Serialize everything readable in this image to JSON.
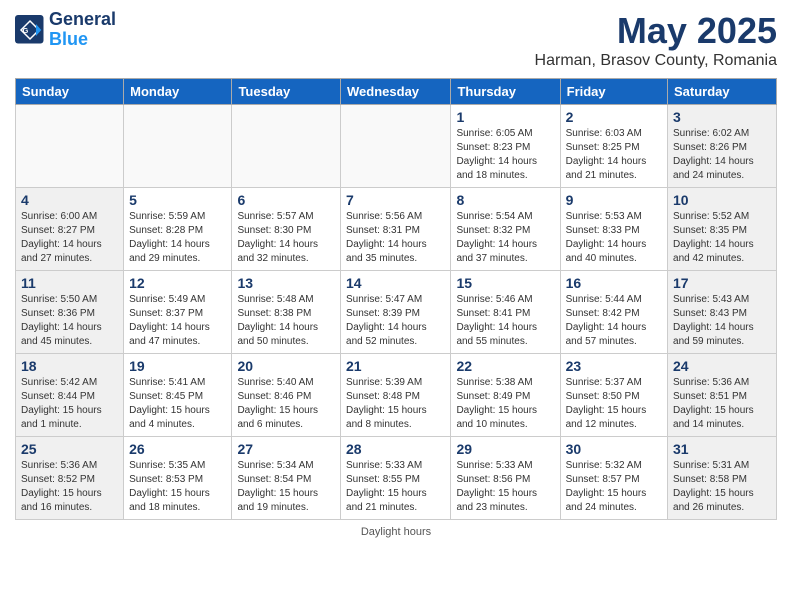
{
  "header": {
    "logo": {
      "general": "General",
      "blue": "Blue"
    },
    "title": "May 2025",
    "location": "Harman, Brasov County, Romania"
  },
  "calendar": {
    "headers": [
      "Sunday",
      "Monday",
      "Tuesday",
      "Wednesday",
      "Thursday",
      "Friday",
      "Saturday"
    ],
    "weeks": [
      [
        {
          "day": "",
          "info": ""
        },
        {
          "day": "",
          "info": ""
        },
        {
          "day": "",
          "info": ""
        },
        {
          "day": "",
          "info": ""
        },
        {
          "day": "1",
          "info": "Sunrise: 6:05 AM\nSunset: 8:23 PM\nDaylight: 14 hours\nand 18 minutes."
        },
        {
          "day": "2",
          "info": "Sunrise: 6:03 AM\nSunset: 8:25 PM\nDaylight: 14 hours\nand 21 minutes."
        },
        {
          "day": "3",
          "info": "Sunrise: 6:02 AM\nSunset: 8:26 PM\nDaylight: 14 hours\nand 24 minutes."
        }
      ],
      [
        {
          "day": "4",
          "info": "Sunrise: 6:00 AM\nSunset: 8:27 PM\nDaylight: 14 hours\nand 27 minutes."
        },
        {
          "day": "5",
          "info": "Sunrise: 5:59 AM\nSunset: 8:28 PM\nDaylight: 14 hours\nand 29 minutes."
        },
        {
          "day": "6",
          "info": "Sunrise: 5:57 AM\nSunset: 8:30 PM\nDaylight: 14 hours\nand 32 minutes."
        },
        {
          "day": "7",
          "info": "Sunrise: 5:56 AM\nSunset: 8:31 PM\nDaylight: 14 hours\nand 35 minutes."
        },
        {
          "day": "8",
          "info": "Sunrise: 5:54 AM\nSunset: 8:32 PM\nDaylight: 14 hours\nand 37 minutes."
        },
        {
          "day": "9",
          "info": "Sunrise: 5:53 AM\nSunset: 8:33 PM\nDaylight: 14 hours\nand 40 minutes."
        },
        {
          "day": "10",
          "info": "Sunrise: 5:52 AM\nSunset: 8:35 PM\nDaylight: 14 hours\nand 42 minutes."
        }
      ],
      [
        {
          "day": "11",
          "info": "Sunrise: 5:50 AM\nSunset: 8:36 PM\nDaylight: 14 hours\nand 45 minutes."
        },
        {
          "day": "12",
          "info": "Sunrise: 5:49 AM\nSunset: 8:37 PM\nDaylight: 14 hours\nand 47 minutes."
        },
        {
          "day": "13",
          "info": "Sunrise: 5:48 AM\nSunset: 8:38 PM\nDaylight: 14 hours\nand 50 minutes."
        },
        {
          "day": "14",
          "info": "Sunrise: 5:47 AM\nSunset: 8:39 PM\nDaylight: 14 hours\nand 52 minutes."
        },
        {
          "day": "15",
          "info": "Sunrise: 5:46 AM\nSunset: 8:41 PM\nDaylight: 14 hours\nand 55 minutes."
        },
        {
          "day": "16",
          "info": "Sunrise: 5:44 AM\nSunset: 8:42 PM\nDaylight: 14 hours\nand 57 minutes."
        },
        {
          "day": "17",
          "info": "Sunrise: 5:43 AM\nSunset: 8:43 PM\nDaylight: 14 hours\nand 59 minutes."
        }
      ],
      [
        {
          "day": "18",
          "info": "Sunrise: 5:42 AM\nSunset: 8:44 PM\nDaylight: 15 hours\nand 1 minute."
        },
        {
          "day": "19",
          "info": "Sunrise: 5:41 AM\nSunset: 8:45 PM\nDaylight: 15 hours\nand 4 minutes."
        },
        {
          "day": "20",
          "info": "Sunrise: 5:40 AM\nSunset: 8:46 PM\nDaylight: 15 hours\nand 6 minutes."
        },
        {
          "day": "21",
          "info": "Sunrise: 5:39 AM\nSunset: 8:48 PM\nDaylight: 15 hours\nand 8 minutes."
        },
        {
          "day": "22",
          "info": "Sunrise: 5:38 AM\nSunset: 8:49 PM\nDaylight: 15 hours\nand 10 minutes."
        },
        {
          "day": "23",
          "info": "Sunrise: 5:37 AM\nSunset: 8:50 PM\nDaylight: 15 hours\nand 12 minutes."
        },
        {
          "day": "24",
          "info": "Sunrise: 5:36 AM\nSunset: 8:51 PM\nDaylight: 15 hours\nand 14 minutes."
        }
      ],
      [
        {
          "day": "25",
          "info": "Sunrise: 5:36 AM\nSunset: 8:52 PM\nDaylight: 15 hours\nand 16 minutes."
        },
        {
          "day": "26",
          "info": "Sunrise: 5:35 AM\nSunset: 8:53 PM\nDaylight: 15 hours\nand 18 minutes."
        },
        {
          "day": "27",
          "info": "Sunrise: 5:34 AM\nSunset: 8:54 PM\nDaylight: 15 hours\nand 19 minutes."
        },
        {
          "day": "28",
          "info": "Sunrise: 5:33 AM\nSunset: 8:55 PM\nDaylight: 15 hours\nand 21 minutes."
        },
        {
          "day": "29",
          "info": "Sunrise: 5:33 AM\nSunset: 8:56 PM\nDaylight: 15 hours\nand 23 minutes."
        },
        {
          "day": "30",
          "info": "Sunrise: 5:32 AM\nSunset: 8:57 PM\nDaylight: 15 hours\nand 24 minutes."
        },
        {
          "day": "31",
          "info": "Sunrise: 5:31 AM\nSunset: 8:58 PM\nDaylight: 15 hours\nand 26 minutes."
        }
      ]
    ]
  },
  "footer": {
    "daylight_label": "Daylight hours"
  }
}
